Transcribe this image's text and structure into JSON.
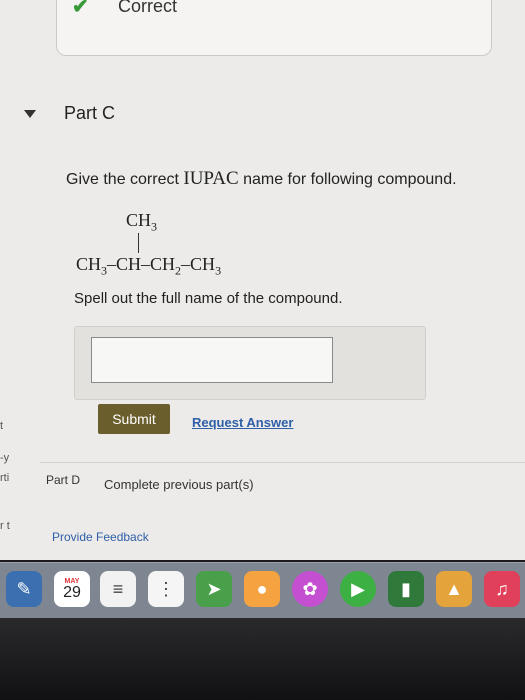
{
  "prev": {
    "status_label": "Correct",
    "check_glyph": "✔"
  },
  "part_c": {
    "title": "Part C",
    "question_pre": "Give the correct ",
    "question_iupac": "IUPAC",
    "question_post": " name for following compound.",
    "structure": {
      "branch": "CH",
      "branch_sub": "3",
      "c1": "CH",
      "c1_sub": "3",
      "dash1": "–",
      "c2": "CH",
      "dash2": "–",
      "c3": "CH",
      "c3_sub": "2",
      "dash3": "–",
      "c4": "CH",
      "c4_sub": "3"
    },
    "instruction": "Spell out the full name of the compound.",
    "answer_value": "",
    "submit_label": "Submit",
    "request_label": "Request Answer"
  },
  "part_d": {
    "label": "Part D",
    "text": "Complete previous part(s)"
  },
  "feedback_label": "Provide Feedback",
  "edge_fragments": [
    "t",
    "-y",
    "rti",
    "r t"
  ],
  "dock": {
    "calendar_month": "MAY",
    "calendar_day": "29"
  },
  "colors": {
    "submit": "#6b5e2d",
    "link": "#2e5fa8",
    "check": "#3a9a3a"
  }
}
